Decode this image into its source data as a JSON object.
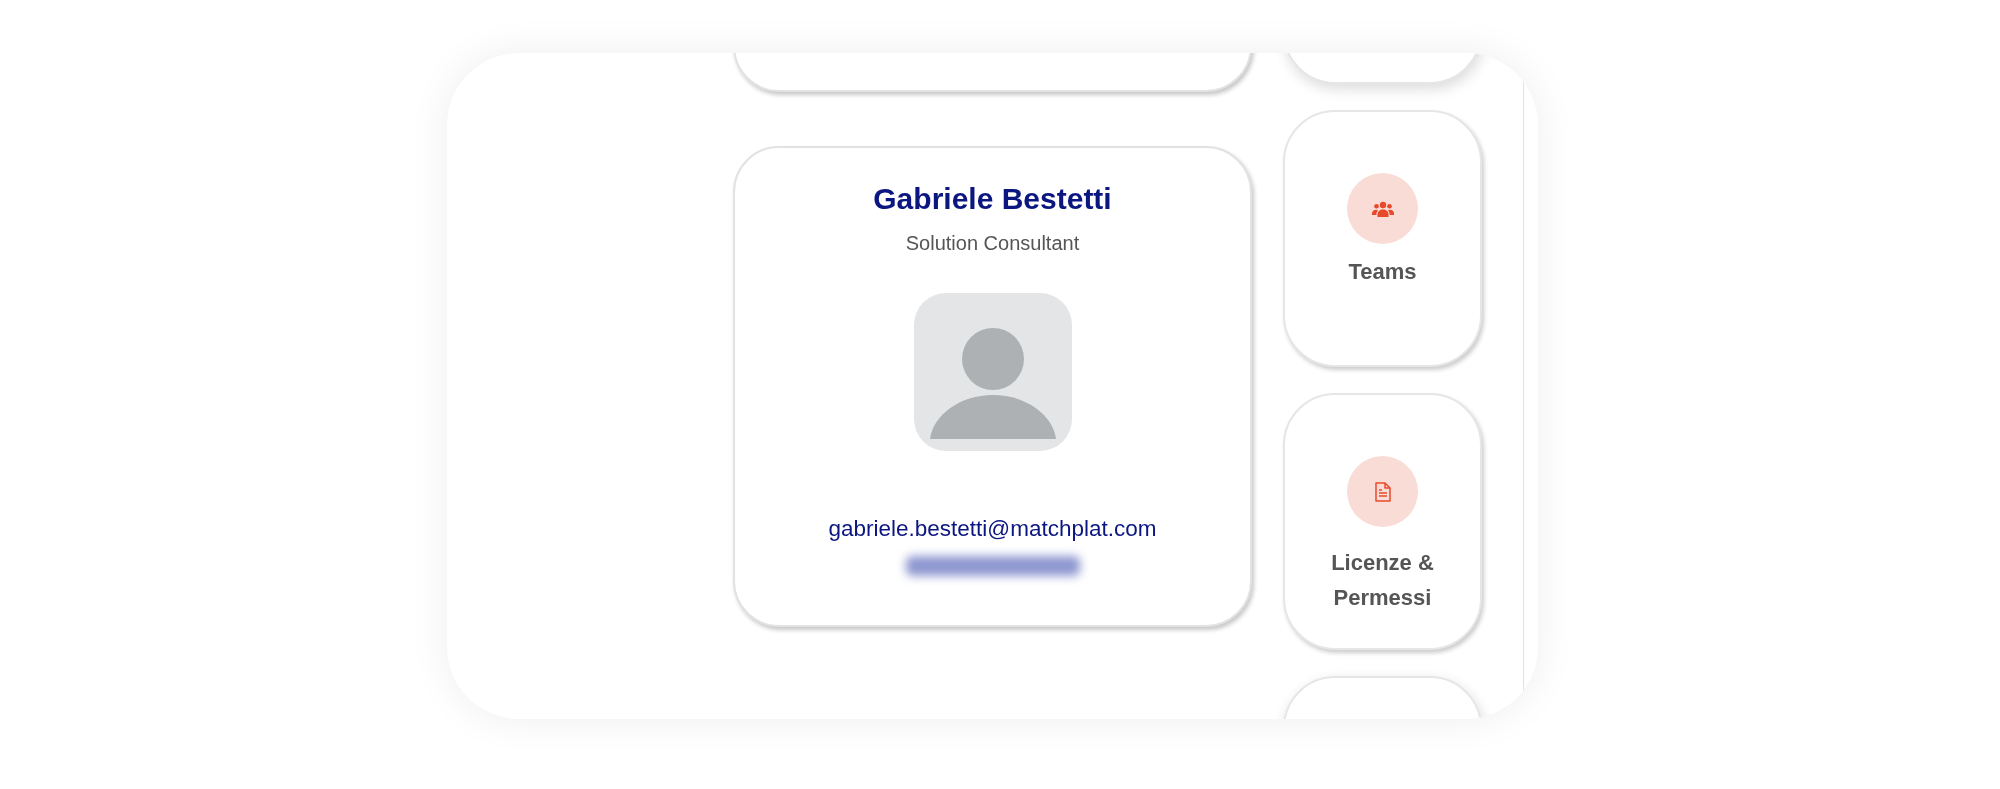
{
  "profile": {
    "name": "Gabriele Bestetti",
    "role": "Solution Consultant",
    "email": "gabriele.bestetti@matchplat.com"
  },
  "tiles": [
    {
      "kind": "teams",
      "label": "Teams"
    },
    {
      "kind": "document",
      "label": "Licenze & Permessi"
    }
  ]
}
